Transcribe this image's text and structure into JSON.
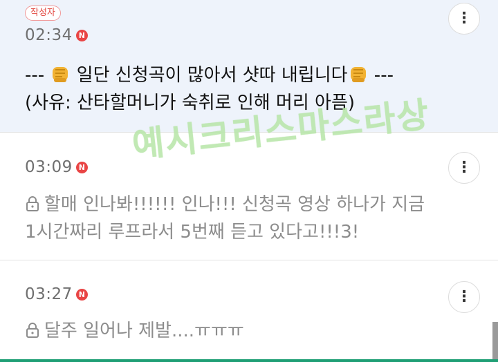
{
  "comments": [
    {
      "author_badge": "작성자",
      "time": "02:34",
      "new_badge": "N",
      "more_icon": "⋮",
      "locked": false,
      "line1_pre": "--- ",
      "line1_mid": " 일단 신청곡이 많아서 샷따 내립니다",
      "line1_post": " ---",
      "line2": "(사유: 산타할머니가 숙취로 인해 머리 아픔)",
      "icons": [
        "fist-emoji-icon",
        "fist-emoji-icon",
        "more-vertical-icon"
      ]
    },
    {
      "time": "03:09",
      "new_badge": "N",
      "more_icon": "⋮",
      "locked": true,
      "line1": "할매 인나봐!!!!!! 인나!!! 신청곡 영상 하나가 지금",
      "line2": "1시간짜리 루프라서 5번째 듣고 있다고!!!3!",
      "icons": [
        "lock-icon",
        "more-vertical-icon"
      ]
    },
    {
      "time": "03:27",
      "new_badge": "N",
      "more_icon": "⋮",
      "locked": true,
      "line1": "달주 일어나 제발....ㅠㅠㅠ",
      "icons": [
        "lock-icon",
        "more-vertical-icon"
      ]
    }
  ],
  "watermark": "예시크리스마스라상",
  "colors": {
    "highlight_bg": "#eef3fb",
    "new_badge": "#e94545",
    "author_badge_text": "#e2473f",
    "locked_text": "#8c8c8c",
    "watermark": "#b7e6a8",
    "bottom_bar": "#1f9f75"
  }
}
